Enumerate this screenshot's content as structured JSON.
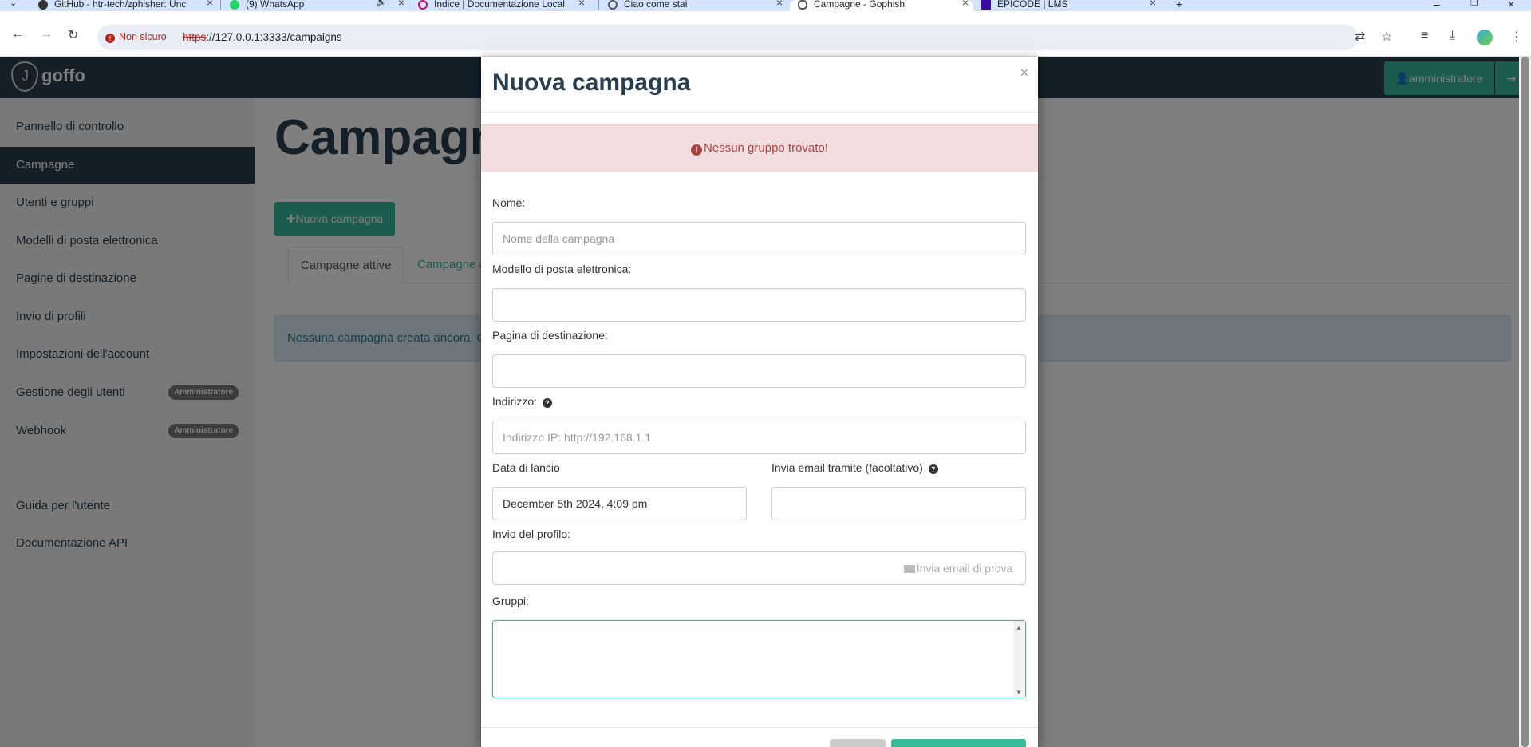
{
  "browser": {
    "tabs": [
      {
        "title": "GitHub - htr-tech/zphisher: Unc",
        "icon": "github-icon"
      },
      {
        "title": "(9) WhatsApp",
        "icon": "whatsapp-icon"
      },
      {
        "title": "Indice | Documentazione Local",
        "icon": "doc-icon"
      },
      {
        "title": "Ciao come stai",
        "icon": "chat-icon"
      },
      {
        "title": "Campagne - Gophish",
        "icon": "gophish-icon"
      },
      {
        "title": "EPICODE | LMS",
        "icon": "epicode-icon"
      }
    ],
    "security_label": "Non sicuro",
    "url_scheme": "https",
    "url_rest": "://127.0.0.1:3333/campaigns"
  },
  "app": {
    "logo_text": "goffo",
    "user_label": "amministratore",
    "sidebar": {
      "items": [
        {
          "label": "Pannello di controllo"
        },
        {
          "label": "Campagne"
        },
        {
          "label": "Utenti e gruppi"
        },
        {
          "label": "Modelli di posta elettronica"
        },
        {
          "label": "Pagine di destinazione"
        },
        {
          "label": "Invio di profili"
        },
        {
          "label": "Impostazioni dell'account"
        },
        {
          "label": "Gestione degli utenti",
          "badge": "Amministratore"
        },
        {
          "label": "Webhook",
          "badge": "Amministratore"
        },
        {
          "label": "Guida per l'utente"
        },
        {
          "label": "Documentazione API"
        }
      ]
    },
    "page_title": "Campagne",
    "new_campaign_button": "Nuova campagna",
    "tabs": [
      "Campagne attive",
      "Campagne archiviate"
    ],
    "empty_message": "Nessuna campagna creata ancora. Crea una nuova campagna per iniziare."
  },
  "modal": {
    "title": "Nuova campagna",
    "close": "×",
    "error": "Nessun gruppo trovato!",
    "fields": {
      "name_label": "Nome:",
      "name_placeholder": "Nome della campagna",
      "template_label": "Modello di posta elettronica:",
      "template_value": "",
      "page_label": "Pagina di destinazione:",
      "page_value": "",
      "url_label": "Indirizzo:",
      "url_placeholder": "Indirizzo IP: http://192.168.1.1",
      "launch_label": "Data di lancio",
      "launch_value": "December 5th 2024, 4:09 pm",
      "send_by_label": "Invia email tramite (facoltativo)",
      "send_by_value": "",
      "profile_label": "Invio del profilo:",
      "profile_value": "",
      "test_email_button": "Invia email di prova",
      "groups_label": "Gruppi:",
      "groups_value": ""
    }
  }
}
